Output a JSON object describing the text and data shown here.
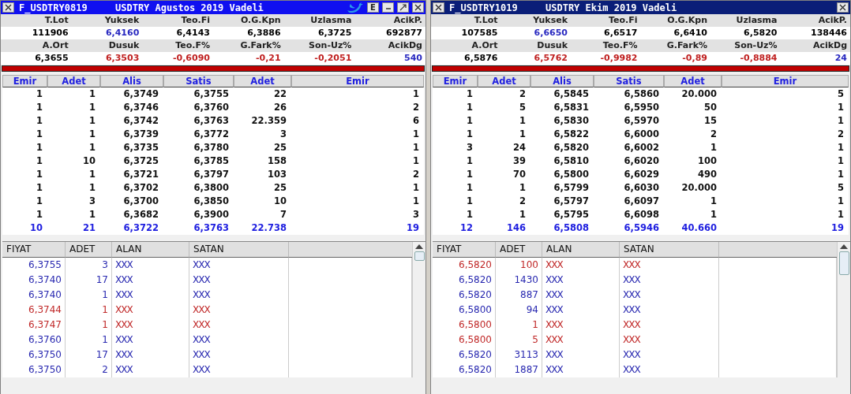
{
  "panels": [
    {
      "code": "F_USDTRY0819",
      "title": "USDTRY Agustos 2019 Vadeli",
      "active": true,
      "extra_controls": true,
      "letter_button": "E",
      "stats": [
        [
          {
            "label": "T.Lot",
            "value": "111906",
            "color": "#000000"
          },
          {
            "label": "Yuksek",
            "value": "6,4160",
            "color": "#2828c0"
          },
          {
            "label": "Teo.Fi",
            "value": "6,4143",
            "color": "#000000"
          },
          {
            "label": "O.G.Kpn",
            "value": "6,3886",
            "color": "#000000"
          },
          {
            "label": "Uzlasma",
            "value": "6,3725",
            "color": "#000000"
          },
          {
            "label": "AcikP.",
            "value": "692877",
            "color": "#000000"
          }
        ],
        [
          {
            "label": "A.Ort",
            "value": "6,3655",
            "color": "#000000"
          },
          {
            "label": "Dusuk",
            "value": "6,3503",
            "color": "#c02020"
          },
          {
            "label": "Teo.F%",
            "value": "-0,6090",
            "color": "#c02020"
          },
          {
            "label": "G.Fark%",
            "value": "-0,21",
            "color": "#c02020"
          },
          {
            "label": "Son-Uz%",
            "value": "-0,2051",
            "color": "#c02020"
          },
          {
            "label": "AcikDg",
            "value": "540",
            "color": "#2828c0"
          }
        ]
      ],
      "book": {
        "columns": [
          "Emir",
          "Adet",
          "Alis",
          "Satis",
          "Adet",
          "Emir"
        ],
        "rows": [
          [
            "1",
            "1",
            "6,3749",
            "6,3755",
            "22",
            "1"
          ],
          [
            "1",
            "1",
            "6,3746",
            "6,3760",
            "26",
            "2"
          ],
          [
            "1",
            "1",
            "6,3742",
            "6,3763",
            "22.359",
            "6"
          ],
          [
            "1",
            "1",
            "6,3739",
            "6,3772",
            "3",
            "1"
          ],
          [
            "1",
            "1",
            "6,3735",
            "6,3780",
            "25",
            "1"
          ],
          [
            "1",
            "10",
            "6,3725",
            "6,3785",
            "158",
            "1"
          ],
          [
            "1",
            "1",
            "6,3721",
            "6,3797",
            "103",
            "2"
          ],
          [
            "1",
            "1",
            "6,3702",
            "6,3800",
            "25",
            "1"
          ],
          [
            "1",
            "3",
            "6,3700",
            "6,3850",
            "10",
            "1"
          ],
          [
            "1",
            "1",
            "6,3682",
            "6,3900",
            "7",
            "3"
          ]
        ],
        "total": [
          "10",
          "21",
          "6,3722",
          "6,3763",
          "22.738",
          "19"
        ]
      },
      "trades": {
        "columns": [
          "FIYAT",
          "ADET",
          "ALAN",
          "SATAN"
        ],
        "rows": [
          {
            "price": "6,3755",
            "qty": "3",
            "buyer": "XXX",
            "seller": "XXX",
            "color": "#2828b0"
          },
          {
            "price": "6,3740",
            "qty": "17",
            "buyer": "XXX",
            "seller": "XXX",
            "color": "#2828b0"
          },
          {
            "price": "6,3740",
            "qty": "1",
            "buyer": "XXX",
            "seller": "XXX",
            "color": "#2828b0"
          },
          {
            "price": "6,3744",
            "qty": "1",
            "buyer": "XXX",
            "seller": "XXX",
            "color": "#c02828"
          },
          {
            "price": "6,3747",
            "qty": "1",
            "buyer": "XXX",
            "seller": "XXX",
            "color": "#c02828"
          },
          {
            "price": "6,3760",
            "qty": "1",
            "buyer": "XXX",
            "seller": "XXX",
            "color": "#2828b0"
          },
          {
            "price": "6,3750",
            "qty": "17",
            "buyer": "XXX",
            "seller": "XXX",
            "color": "#2828b0"
          },
          {
            "price": "6,3750",
            "qty": "2",
            "buyer": "XXX",
            "seller": "XXX",
            "color": "#2828b0"
          }
        ]
      }
    },
    {
      "code": "F_USDTRY1019",
      "title": "USDTRY Ekim 2019 Vadeli",
      "active": false,
      "extra_controls": false,
      "stats": [
        [
          {
            "label": "T.Lot",
            "value": "107585",
            "color": "#000000"
          },
          {
            "label": "Yuksek",
            "value": "6,6650",
            "color": "#2828c0"
          },
          {
            "label": "Teo.Fi",
            "value": "6,6517",
            "color": "#000000"
          },
          {
            "label": "O.G.Kpn",
            "value": "6,6410",
            "color": "#000000"
          },
          {
            "label": "Uzlasma",
            "value": "6,5820",
            "color": "#000000"
          },
          {
            "label": "AcikP.",
            "value": "138446",
            "color": "#000000"
          }
        ],
        [
          {
            "label": "A.Ort",
            "value": "6,5876",
            "color": "#000000"
          },
          {
            "label": "Dusuk",
            "value": "6,5762",
            "color": "#c02020"
          },
          {
            "label": "Teo.F%",
            "value": "-0,9982",
            "color": "#c02020"
          },
          {
            "label": "G.Fark%",
            "value": "-0,89",
            "color": "#c02020"
          },
          {
            "label": "Son-Uz%",
            "value": "-0,8884",
            "color": "#c02020"
          },
          {
            "label": "AcikDg",
            "value": "24",
            "color": "#2828c0"
          }
        ]
      ],
      "book": {
        "columns": [
          "Emir",
          "Adet",
          "Alis",
          "Satis",
          "Adet",
          "Emir"
        ],
        "rows": [
          [
            "1",
            "2",
            "6,5845",
            "6,5860",
            "20.000",
            "5"
          ],
          [
            "1",
            "5",
            "6,5831",
            "6,5950",
            "50",
            "1"
          ],
          [
            "1",
            "1",
            "6,5830",
            "6,5970",
            "15",
            "1"
          ],
          [
            "1",
            "1",
            "6,5822",
            "6,6000",
            "2",
            "2"
          ],
          [
            "3",
            "24",
            "6,5820",
            "6,6002",
            "1",
            "1"
          ],
          [
            "1",
            "39",
            "6,5810",
            "6,6020",
            "100",
            "1"
          ],
          [
            "1",
            "70",
            "6,5800",
            "6,6029",
            "490",
            "1"
          ],
          [
            "1",
            "1",
            "6,5799",
            "6,6030",
            "20.000",
            "5"
          ],
          [
            "1",
            "2",
            "6,5797",
            "6,6097",
            "1",
            "1"
          ],
          [
            "1",
            "1",
            "6,5795",
            "6,6098",
            "1",
            "1"
          ]
        ],
        "total": [
          "12",
          "146",
          "6,5808",
          "6,5946",
          "40.660",
          "19"
        ]
      },
      "trades": {
        "columns": [
          "FIYAT",
          "ADET",
          "ALAN",
          "SATAN"
        ],
        "rows": [
          {
            "price": "6,5820",
            "qty": "100",
            "buyer": "XXX",
            "seller": "XXX",
            "color": "#c02828"
          },
          {
            "price": "6,5820",
            "qty": "1430",
            "buyer": "XXX",
            "seller": "XXX",
            "color": "#2828b0"
          },
          {
            "price": "6,5820",
            "qty": "887",
            "buyer": "XXX",
            "seller": "XXX",
            "color": "#2828b0"
          },
          {
            "price": "6,5800",
            "qty": "94",
            "buyer": "XXX",
            "seller": "XXX",
            "color": "#2828b0"
          },
          {
            "price": "6,5800",
            "qty": "1",
            "buyer": "XXX",
            "seller": "XXX",
            "color": "#c02828"
          },
          {
            "price": "6,5800",
            "qty": "5",
            "buyer": "XXX",
            "seller": "XXX",
            "color": "#c02828"
          },
          {
            "price": "6,5820",
            "qty": "3113",
            "buyer": "XXX",
            "seller": "XXX",
            "color": "#2828b0"
          },
          {
            "price": "6,5820",
            "qty": "1887",
            "buyer": "XXX",
            "seller": "XXX",
            "color": "#2828b0"
          }
        ]
      }
    }
  ]
}
